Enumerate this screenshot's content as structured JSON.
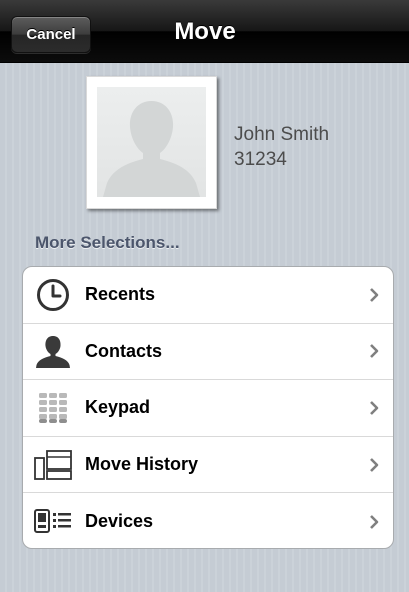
{
  "navbar": {
    "cancel_label": "Cancel",
    "title": "Move"
  },
  "contact": {
    "avatar_icon": "person-silhouette-icon",
    "name": "John Smith",
    "number": "31234"
  },
  "more_selections": {
    "title": "More Selections...",
    "items": [
      {
        "label": "Recents",
        "icon": "clock-icon"
      },
      {
        "label": "Contacts",
        "icon": "person-icon"
      },
      {
        "label": "Keypad",
        "icon": "keypad-icon"
      },
      {
        "label": "Move History",
        "icon": "move-history-icon"
      },
      {
        "label": "Devices",
        "icon": "devices-icon"
      }
    ]
  },
  "colors": {
    "navbar": "#000000",
    "background": "#c5ccd4",
    "section_title": "#4c566c",
    "chevron": "#7f7f7f"
  }
}
